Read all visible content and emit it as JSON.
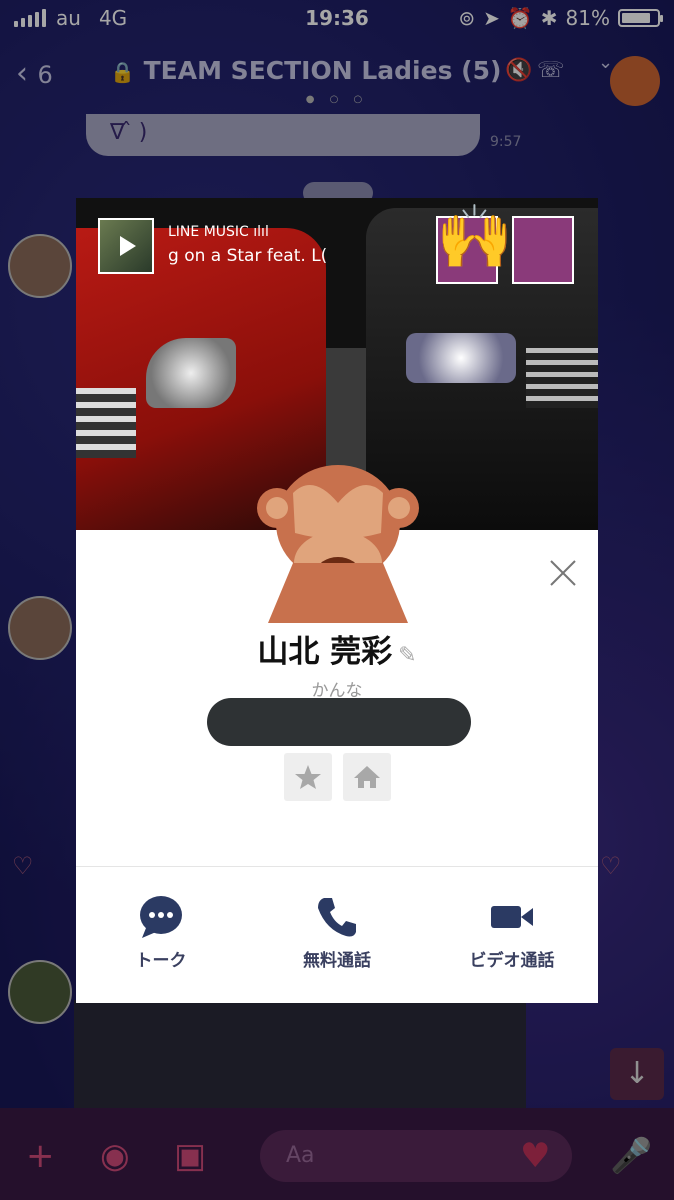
{
  "status_bar": {
    "carrier": "au",
    "network": "4G",
    "time": "19:36",
    "battery": "81%",
    "battery_level": 0.81
  },
  "chat_header": {
    "back_count": "6",
    "title": "TEAM SECTION Ladies (5)"
  },
  "background_chat": {
    "bubble_text": "∇ ̂ )",
    "bubble_time": "9:57",
    "composer_placeholder": "Aa"
  },
  "profile_card": {
    "music_label": "LINE MUSIC",
    "song_title": "g on a Star feat. L(",
    "name": "山北 莞彩",
    "furigana": "かんな",
    "actions": [
      {
        "label": "トーク",
        "icon": "chat-bubble-icon"
      },
      {
        "label": "無料通話",
        "icon": "phone-icon"
      },
      {
        "label": "ビデオ通話",
        "icon": "video-camera-icon"
      }
    ]
  },
  "colors": {
    "accent_navy": "#2b3a63",
    "chat_bg": "#181858",
    "composer_pink": "#d04a7a"
  }
}
